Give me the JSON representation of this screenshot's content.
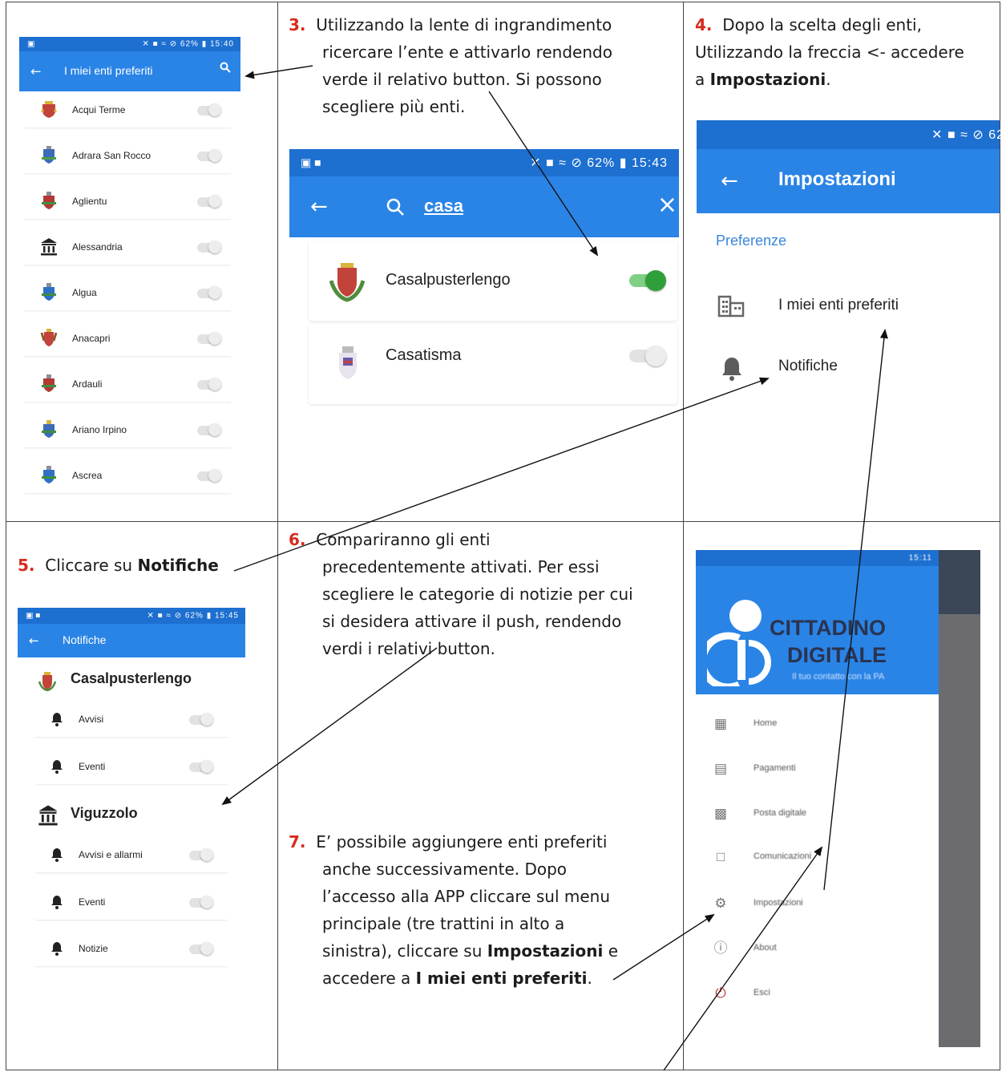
{
  "step3": {
    "num": "3.",
    "line1": "Utilizzando la lente di ingrandimento",
    "line2": "ricercare l’ente e attivarlo rendendo",
    "line3": "verde il relativo button. Si possono",
    "line4": "scegliere più enti."
  },
  "step4": {
    "num": "4.",
    "line1": "Dopo la scelta degli enti,",
    "line2": "Utilizzando la freccia <- accedere",
    "line3_pre": "a ",
    "line3_bold": "Impostazioni",
    "line3_post": "."
  },
  "step5": {
    "num": "5.",
    "text_pre": "Cliccare su ",
    "text_bold": "Notifiche"
  },
  "step6": {
    "num": "6.",
    "line1": "Compariranno gli enti",
    "line2": "precedentemente attivati. Per essi",
    "line3": "scegliere le categorie di notizie per cui",
    "line4": "si desidera attivare il push, rendendo",
    "line5": "verdi  i relativi button."
  },
  "step7": {
    "num": "7.",
    "line1": "E’ possibile aggiungere enti preferiti",
    "line2": "anche successivamente. Dopo",
    "line3": "l’accesso alla APP cliccare sul menu",
    "line4": "principale (tre trattini in alto a",
    "line5_pre": "sinistra), cliccare su ",
    "line5_bold": "Impostazioni",
    "line5_post": " e",
    "line6_pre": "accedere a ",
    "line6_bold": "I miei enti preferiti",
    "line6_post": "."
  },
  "screen1": {
    "status_left": "▣",
    "status_right": "✕ ■ ≈ ⊘ 62% ▮ 15:40",
    "title": "I miei enti preferiti",
    "items": [
      {
        "label": "Acqui Terme"
      },
      {
        "label": "Adrara San Rocco"
      },
      {
        "label": "Aglientu"
      },
      {
        "label": "Alessandria"
      },
      {
        "label": "Algua"
      },
      {
        "label": "Anacapri"
      },
      {
        "label": "Ardauli"
      },
      {
        "label": "Ariano Irpino"
      },
      {
        "label": "Ascrea"
      }
    ]
  },
  "screen2": {
    "status_left": "▣ ■",
    "status_right": "✕ ■ ≈ ⊘ 62% ▮ 15:43",
    "search_value": "casa",
    "items": [
      {
        "label": "Casalpusterlengo",
        "on": true
      },
      {
        "label": "Casatisma",
        "on": false
      }
    ]
  },
  "screen3": {
    "status_right": "✕ ■ ≈ ⊘ 62",
    "title": "Impostazioni",
    "section": "Preferenze",
    "item1": "I miei enti preferiti",
    "item2": "Notifiche"
  },
  "screen4": {
    "status_left": "▣ ■",
    "status_right": "✕ ■ ≈ ⊘ 62% ▮ 15:45",
    "title": "Notifiche",
    "group1": "Casalpusterlengo",
    "group1_items": [
      "Avvisi",
      "Eventi"
    ],
    "group2": "Viguzzolo",
    "group2_items": [
      "Avvisi e allarmi",
      "Eventi",
      "Notizie"
    ]
  },
  "screen5": {
    "status_right": "15:11",
    "brand_line1": "CITTADINO",
    "brand_line2": "DIGITALE",
    "tagline": "Il tuo contatto con la PA",
    "items": [
      "Home",
      "Pagamenti",
      "Posta digitale",
      "Comunicazioni",
      "Impostazioni",
      "About",
      "Esci"
    ]
  },
  "colors": {
    "accent": "#2a84e6",
    "statusbar": "#1d6fd0",
    "step_number": "#d62b1e",
    "toggle_on": "#2f9f3a"
  }
}
